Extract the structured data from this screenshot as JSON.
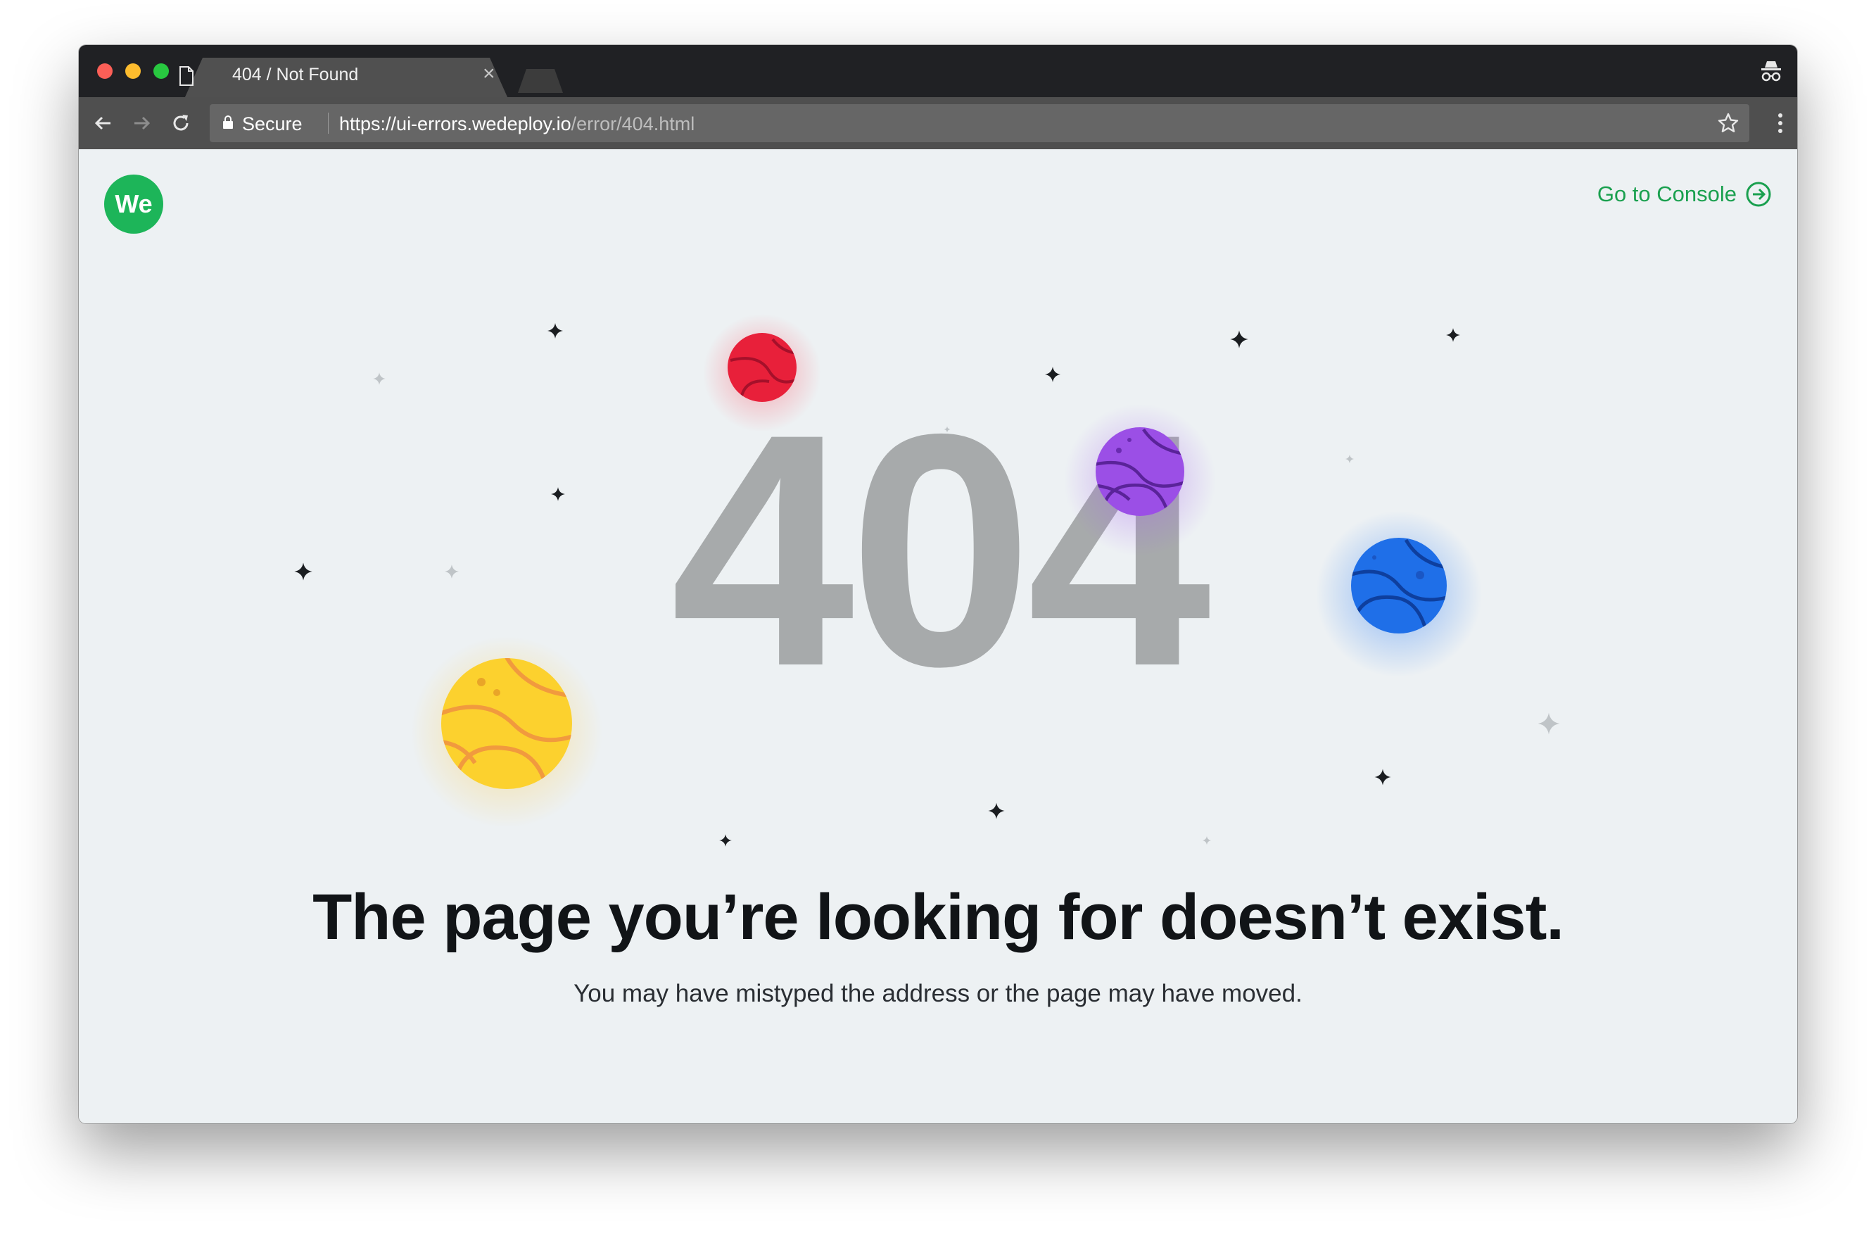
{
  "browser": {
    "tab": {
      "title": "404 / Not Found",
      "close": "×",
      "icon": "document-icon"
    },
    "toolbar": {
      "back_icon": "back-arrow-icon",
      "forward_icon": "forward-arrow-icon",
      "reload_icon": "reload-icon",
      "security_label": "Secure",
      "url_scheme": "https://",
      "url_host": "ui-errors.wedeploy.io",
      "url_path": "/error/404.html",
      "bookmark_icon": "star-icon",
      "menu_icon": "vertical-dots-icon"
    },
    "profile_icon": "incognito-icon"
  },
  "page": {
    "logo_text": "We",
    "console_link": "Go to Console",
    "console_icon": "arrow-circle-right-icon",
    "error_code": "404",
    "headline": "The page you’re looking for doesn’t exist.",
    "subtext": "You may have mistyped the address or the page may have moved."
  },
  "colors": {
    "brand_green": "#1db559",
    "link_green": "#1aa04f",
    "background": "#edf1f3",
    "digits": "#a7aaab",
    "planet_red": "#e8203a",
    "planet_purple": "#9b4fe6",
    "planet_blue": "#1f6fe8",
    "planet_yellow": "#fcd12e"
  }
}
